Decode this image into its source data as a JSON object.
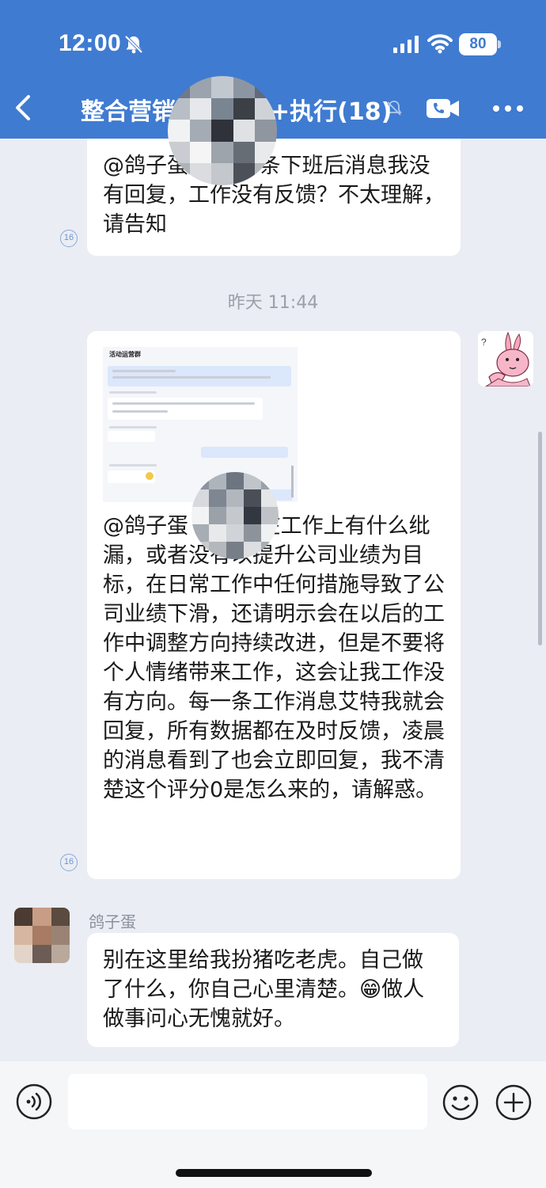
{
  "status_bar": {
    "time": "12:00",
    "battery": "80"
  },
  "header": {
    "title_left": "整合营销",
    "title_right": "+执行(18)"
  },
  "messages": [
    {
      "text": "@鸽子蛋          请问哪条下班后消息我没有回复，工作没有反馈？不太理解，请告知",
      "read_count": "16"
    },
    {
      "text": "@鸽子蛋              如果我在工作上有什么纰漏，或者没有以提升公司业绩为目标，在日常工作中任何措施导致了公司业绩下滑，还请明示会在以后的工作中调整方向持续改进，但是不要将个人情绪带来工作，这会让我工作没有方向。每一条工作消息艾特我就会回复，所有数据都在及时反馈，凌晨的消息看到了也会立即回复，我不清楚这个评分0是怎么来的，请解惑。",
      "read_count": "16"
    },
    {
      "sender": "鸽子蛋",
      "text": "别在这里给我扮猪吃老虎。自己做了什么，你自己心里清楚。😁做人做事问心无愧就好。"
    }
  ],
  "timestamp": "昨天 11:44",
  "thumbnail": {
    "title": "活动运营群"
  },
  "colors": {
    "header_bg": "#3f7bd1",
    "chat_bg": "#eaedf3",
    "bubble_bg": "#ffffff"
  },
  "icons": [
    "back-icon",
    "mute-bell-icon",
    "video-call-icon",
    "more-icon",
    "voice-icon",
    "emoji-icon",
    "plus-icon"
  ]
}
